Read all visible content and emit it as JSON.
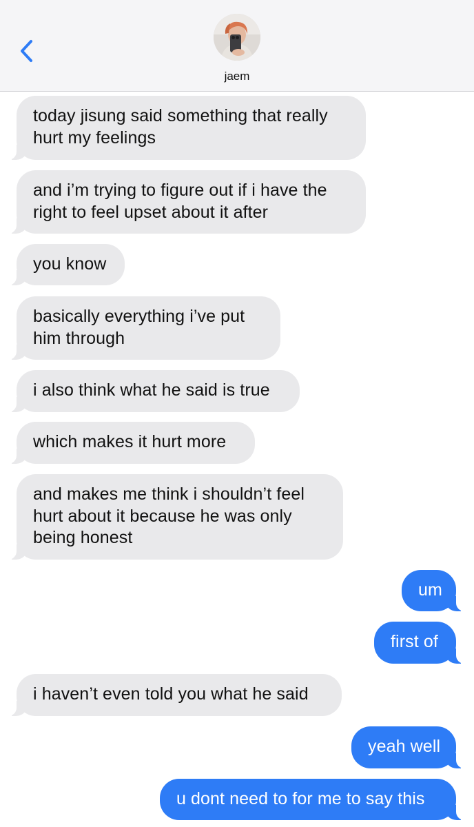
{
  "header": {
    "contact_name": "jaem",
    "back_icon": "chevron-left-icon",
    "avatar_icon": "contact-avatar"
  },
  "colors": {
    "incoming_bubble": "#e9e9eb",
    "outgoing_bubble": "#2e7cf6",
    "back_chevron": "#2e7cf6",
    "header_background": "#f5f5f7"
  },
  "messages": [
    {
      "direction": "incoming",
      "text": "today jisung said something that really\nhurt my feelings"
    },
    {
      "direction": "incoming",
      "text": "and i’m trying to figure out if i have the\nright to feel upset about it after"
    },
    {
      "direction": "incoming",
      "text": "you know"
    },
    {
      "direction": "incoming",
      "text": "basically everything i’ve put\nhim through"
    },
    {
      "direction": "incoming",
      "text": "i also think what he said is true"
    },
    {
      "direction": "incoming",
      "text": "which makes it hurt more"
    },
    {
      "direction": "incoming",
      "text": "and makes me think i shouldn’t feel\nhurt about it because he was only\nbeing honest"
    },
    {
      "direction": "outgoing",
      "text": "um"
    },
    {
      "direction": "outgoing",
      "text": "first of"
    },
    {
      "direction": "incoming",
      "text": "i haven’t even told you what he said"
    },
    {
      "direction": "outgoing",
      "text": "yeah well"
    },
    {
      "direction": "outgoing",
      "text": "u dont need to for me to say this"
    }
  ]
}
